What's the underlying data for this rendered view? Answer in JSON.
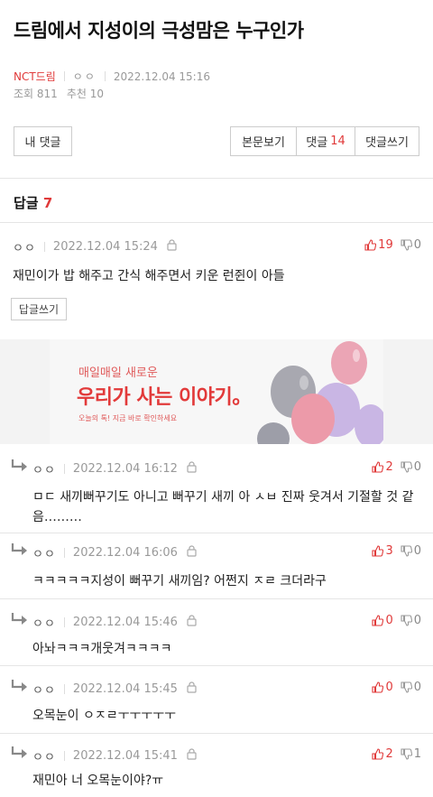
{
  "post": {
    "title": "드림에서 지성이의 극성맘은 누구인가",
    "board": "NCT드림",
    "author": "ㅇㅇ",
    "date": "2022.12.04 15:16",
    "views": "조회 811",
    "likes": "추천 10"
  },
  "actions": {
    "my_comments": "내 댓글",
    "view_post": "본문보기",
    "comments_label": "댓글",
    "comments_count": "14",
    "write_comment": "댓글쓰기"
  },
  "replies": {
    "label": "답글",
    "count": "7"
  },
  "comments": [
    {
      "author": "ㅇㅇ",
      "date": "2022.12.04 15:24",
      "up": "19",
      "down": "0",
      "text": "재민이가 밥 해주고 간식 해주면서 키운 런쥔이 아들",
      "reply_label": "답글쓰기"
    },
    {
      "author": "ㅇㅇ",
      "date": "2022.12.04 16:12",
      "up": "2",
      "down": "0",
      "text": "ㅁㄷ 새끼뻐꾸기도 아니고 뻐꾸기 새끼 아 ㅅㅂ 진짜 웃겨서 기절할 것 같음………"
    },
    {
      "author": "ㅇㅇ",
      "date": "2022.12.04 16:06",
      "up": "3",
      "down": "0",
      "text": "ㅋㅋㅋㅋㅋ지성이 뻐꾸기 새끼임? 어쩐지 ㅈㄹ 크더라구"
    },
    {
      "author": "ㅇㅇ",
      "date": "2022.12.04 15:46",
      "up": "0",
      "down": "0",
      "text": "아놔ㅋㅋㅋ개웃겨ㅋㅋㅋㅋ"
    },
    {
      "author": "ㅇㅇ",
      "date": "2022.12.04 15:45",
      "up": "0",
      "down": "0",
      "text": "오목눈이 ㅇㅈㄹㅜㅜㅜㅜㅜ"
    },
    {
      "author": "ㅇㅇ",
      "date": "2022.12.04 15:41",
      "up": "2",
      "down": "1",
      "text": "재민아 너 오목눈이야?ㅠ"
    }
  ],
  "ad": {
    "line1": "매일매일 새로운",
    "line2": "우리가 사는 이야기。",
    "line3": "오늘의 톡! 지금 바로 확인하세요"
  },
  "colors": {
    "accent": "#e03a3a",
    "balloon_pink": "#e8a7b6",
    "balloon_gray": "#a9a9b0",
    "balloon_purple": "#c5b5e0"
  }
}
